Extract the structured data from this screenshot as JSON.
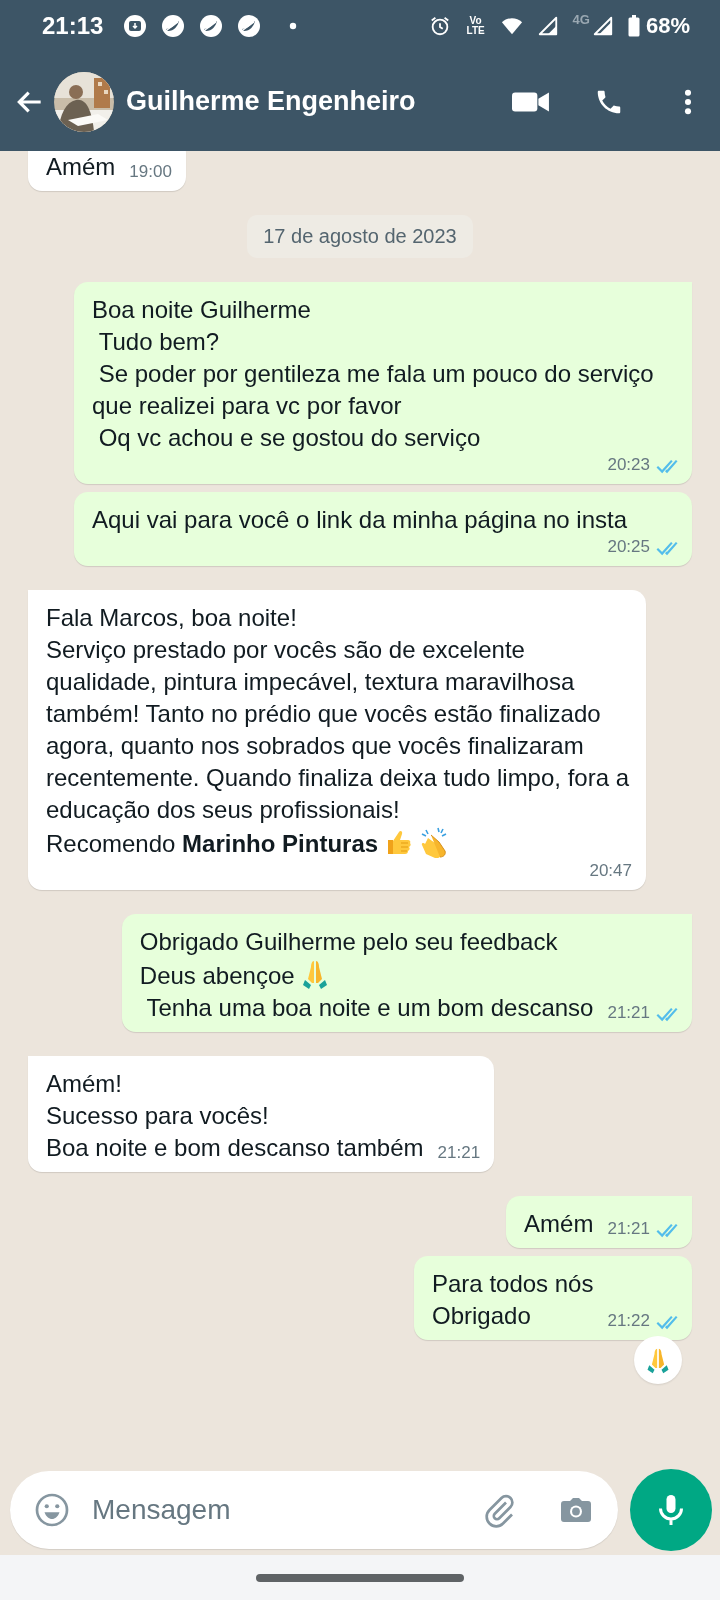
{
  "status_bar": {
    "time": "21:13",
    "volte": "Vo LTE",
    "network": "4G",
    "battery": "68%"
  },
  "header": {
    "contact_name": "Guilherme Engenheiro"
  },
  "chat": [
    {
      "kind": "message",
      "outgoing": false,
      "lines": [
        [
          {
            "kind": "text",
            "text": "Amém"
          }
        ]
      ],
      "time": "19:00"
    },
    {
      "kind": "date",
      "text": "17 de agosto de 2023"
    },
    {
      "kind": "message",
      "outgoing": true,
      "lines": [
        [
          {
            "kind": "text",
            "text": "Boa noite Guilherme"
          }
        ],
        [
          {
            "kind": "text",
            "text": " Tudo bem?"
          }
        ],
        [
          {
            "kind": "text",
            "text": " Se poder por gentileza me fala um pouco do serviço que realizei para vc por favor"
          }
        ],
        [
          {
            "kind": "text",
            "text": " Oq vc achou e se gostou do serviço"
          }
        ]
      ],
      "time": "20:23",
      "read": true
    },
    {
      "kind": "message",
      "outgoing": true,
      "lines": [
        [
          {
            "kind": "text",
            "text": "Aqui vai para você o link da minha página no insta"
          }
        ]
      ],
      "time": "20:25",
      "read": true
    },
    {
      "kind": "message",
      "outgoing": false,
      "lines": [
        [
          {
            "kind": "text",
            "text": "Fala Marcos, boa noite!"
          }
        ],
        [
          {
            "kind": "text",
            "text": "Serviço prestado por vocês são de excelente qualidade, pintura impecável, textura maravilhosa também! Tanto no prédio que vocês estão finalizado agora, quanto nos sobrados que vocês finalizaram recentemente. Quando finaliza deixa tudo limpo, fora a educação dos seus profissionais!"
          }
        ],
        [
          {
            "kind": "text",
            "text": "Recomendo **Marinho Pinturas**"
          },
          {
            "kind": "thumbsup"
          },
          {
            "kind": "clap"
          }
        ]
      ],
      "time": "20:47"
    },
    {
      "kind": "message",
      "outgoing": true,
      "lines": [
        [
          {
            "kind": "text",
            "text": "Obrigado Guilherme pelo seu feedback"
          }
        ],
        [
          {
            "kind": "text",
            "text": "Deus abençoe"
          },
          {
            "kind": "pray"
          }
        ],
        [
          {
            "kind": "text",
            "text": " Tenha uma boa noite e um bom descanso"
          }
        ]
      ],
      "time": "21:21",
      "read": true
    },
    {
      "kind": "message",
      "outgoing": false,
      "lines": [
        [
          {
            "kind": "text",
            "text": "Amém!"
          }
        ],
        [
          {
            "kind": "text",
            "text": "Sucesso para vocês!"
          }
        ],
        [
          {
            "kind": "text",
            "text": "Boa noite e bom descanso também"
          }
        ]
      ],
      "time": "21:21"
    },
    {
      "kind": "message",
      "outgoing": true,
      "lines": [
        [
          {
            "kind": "text",
            "text": "Amém"
          }
        ]
      ],
      "time": "21:21",
      "read": true
    },
    {
      "kind": "message",
      "outgoing": true,
      "lines": [
        [
          {
            "kind": "text",
            "text": "Para todos nós"
          }
        ],
        [
          {
            "kind": "text",
            "text": "Obrigado"
          }
        ]
      ],
      "time": "21:22",
      "read": true,
      "reaction": {
        "kind": "pray"
      }
    }
  ],
  "composer": {
    "placeholder": "Mensagem"
  }
}
